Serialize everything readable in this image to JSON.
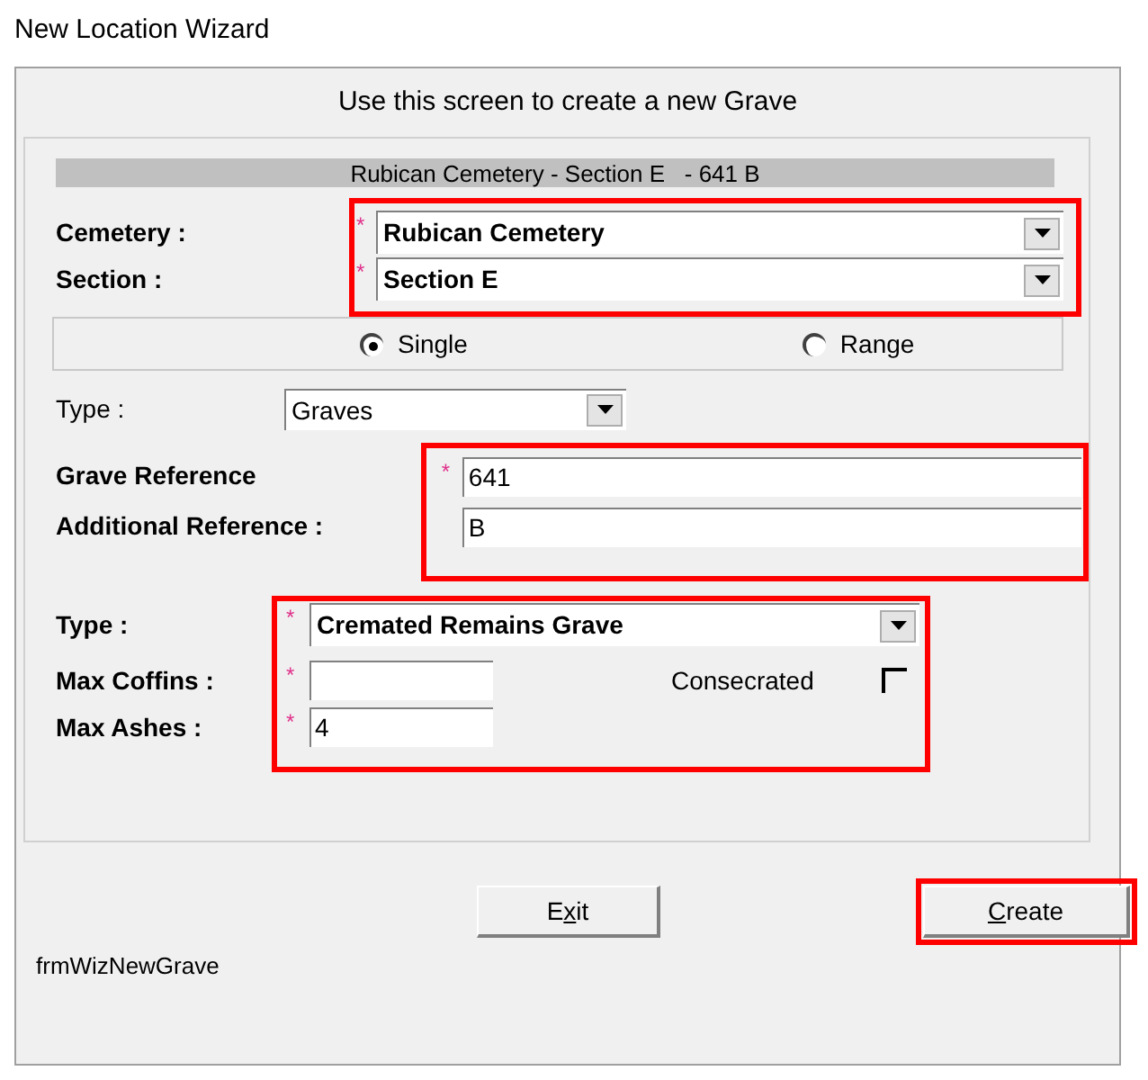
{
  "window": {
    "title": "New Location Wizard"
  },
  "header": "Use this screen to create a new Grave",
  "summary": "Rubican Cemetery - Section E   - 641 B",
  "location": {
    "highlighted": true,
    "fields": [
      {
        "label": "Cemetery :",
        "required_mark": "*",
        "value": "Rubican Cemetery"
      },
      {
        "label": "Section :",
        "required_mark": "*",
        "value": "Section E"
      }
    ]
  },
  "mode": [
    {
      "label": "Single",
      "selected": true
    },
    {
      "label": "Range",
      "selected": false
    }
  ],
  "type_filter": {
    "label": "Type :",
    "value": "Graves"
  },
  "references": {
    "highlighted": true,
    "fields": [
      {
        "label": "Grave Reference",
        "required_mark": "*",
        "value": "641"
      },
      {
        "label": "Additional Reference :",
        "value": "B"
      }
    ]
  },
  "grave_type": {
    "highlighted": true,
    "type": {
      "label": "Type :",
      "required_mark": "*",
      "value": "Cremated Remains Grave"
    },
    "max_coffins": {
      "label": "Max Coffins :",
      "required_mark": "*"
    },
    "max_ashes": {
      "label": "Max Ashes :",
      "required_mark": "*",
      "value": "4"
    },
    "consecrated": {
      "label": "Consecrated",
      "checked": false
    }
  },
  "buttons": [
    {
      "label_before": "E",
      "access_key": "x",
      "label_after": "it",
      "highlighted": false
    },
    {
      "access_key": "C",
      "label_after": "reate",
      "highlighted": true
    }
  ],
  "form_name": "frmWizNewGrave"
}
